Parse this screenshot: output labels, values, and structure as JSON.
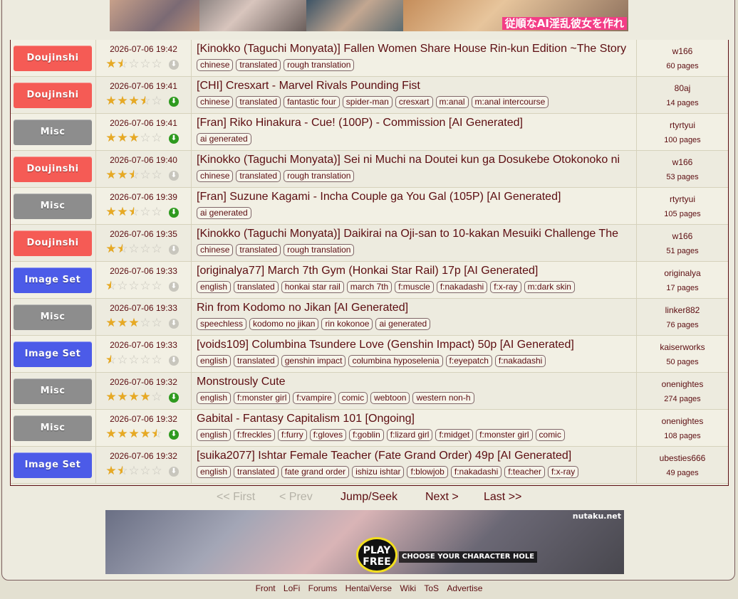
{
  "banner_top": {
    "overlay_text": "従順なAI淫乱彼女を作れ"
  },
  "rows": [
    {
      "category": "Doujinshi",
      "cat_color": "#f55b55",
      "date": "2026-07-06 19:42",
      "rating": 1.5,
      "downloadable": false,
      "title": "[Kinokko (Taguchi Monyata)] Fallen Women Share House Rin-kun Edition ~The Story",
      "tags": [
        "chinese",
        "translated",
        "rough translation"
      ],
      "uploader": "w166",
      "pages": "60 pages"
    },
    {
      "category": "Doujinshi",
      "cat_color": "#f55b55",
      "date": "2026-07-06 19:41",
      "rating": 3.5,
      "downloadable": true,
      "title": "[CHI] Cresxart - Marvel Rivals Pounding Fist",
      "tags": [
        "chinese",
        "translated",
        "fantastic four",
        "spider-man",
        "cresxart",
        "m:anal",
        "m:anal intercourse"
      ],
      "uploader": "80aj",
      "pages": "14 pages"
    },
    {
      "category": "Misc",
      "cat_color": "#8d8d8d",
      "date": "2026-07-06 19:41",
      "rating": 3,
      "downloadable": true,
      "title": "[Fran] Riko Hinakura - Cue! (100P) - Commission [AI Generated]",
      "tags": [
        "ai generated"
      ],
      "uploader": "rtyrtyui",
      "pages": "100 pages"
    },
    {
      "category": "Doujinshi",
      "cat_color": "#f55b55",
      "date": "2026-07-06 19:40",
      "rating": 2.5,
      "downloadable": false,
      "title": "[Kinokko (Taguchi Monyata)] Sei ni Muchi na Doutei kun ga Dosukebe Otokonoko ni",
      "tags": [
        "chinese",
        "translated",
        "rough translation"
      ],
      "uploader": "w166",
      "pages": "53 pages"
    },
    {
      "category": "Misc",
      "cat_color": "#8d8d8d",
      "date": "2026-07-06 19:39",
      "rating": 2.5,
      "downloadable": true,
      "title": "[Fran] Suzune Kagami - Incha Couple ga You Gal (105P) [AI Generated]",
      "tags": [
        "ai generated"
      ],
      "uploader": "rtyrtyui",
      "pages": "105 pages"
    },
    {
      "category": "Doujinshi",
      "cat_color": "#f55b55",
      "date": "2026-07-06 19:35",
      "rating": 1.5,
      "downloadable": false,
      "title": "[Kinokko (Taguchi Monyata)] Daikirai na Oji-san to 10-kakan Mesuiki Challenge The",
      "tags": [
        "chinese",
        "translated",
        "rough translation"
      ],
      "uploader": "w166",
      "pages": "51 pages"
    },
    {
      "category": "Image Set",
      "cat_color": "#4c5be8",
      "date": "2026-07-06 19:33",
      "rating": 0.5,
      "downloadable": false,
      "title": "[originalya77] March 7th Gym (Honkai Star Rail) 17p [AI Generated]",
      "tags": [
        "english",
        "translated",
        "honkai star rail",
        "march 7th",
        "f:muscle",
        "f:nakadashi",
        "f:x-ray",
        "m:dark skin"
      ],
      "uploader": "originalya",
      "pages": "17 pages"
    },
    {
      "category": "Misc",
      "cat_color": "#8d8d8d",
      "date": "2026-07-06 19:33",
      "rating": 3,
      "downloadable": false,
      "title": "Rin from Kodomo no Jikan [AI Generated]",
      "tags": [
        "speechless",
        "kodomo no jikan",
        "rin kokonoe",
        "ai generated"
      ],
      "uploader": "linker882",
      "pages": "76 pages"
    },
    {
      "category": "Image Set",
      "cat_color": "#4c5be8",
      "date": "2026-07-06 19:33",
      "rating": 0.5,
      "downloadable": false,
      "title": "[voids109] Columbina Tsundere Love (Genshin Impact) 50p [AI Generated]",
      "tags": [
        "english",
        "translated",
        "genshin impact",
        "columbina hyposelenia",
        "f:eyepatch",
        "f:nakadashi"
      ],
      "uploader": "kaiserworks",
      "pages": "50 pages"
    },
    {
      "category": "Misc",
      "cat_color": "#8d8d8d",
      "date": "2026-07-06 19:32",
      "rating": 4,
      "downloadable": true,
      "title": "Monstrously Cute",
      "tags": [
        "english",
        "f:monster girl",
        "f:vampire",
        "comic",
        "webtoon",
        "western non-h"
      ],
      "uploader": "onenightes",
      "pages": "274 pages"
    },
    {
      "category": "Misc",
      "cat_color": "#8d8d8d",
      "date": "2026-07-06 19:32",
      "rating": 4.5,
      "downloadable": true,
      "title": "Gabital - Fantasy Capitalism 101 [Ongoing]",
      "tags": [
        "english",
        "f:freckles",
        "f:furry",
        "f:gloves",
        "f:goblin",
        "f:lizard girl",
        "f:midget",
        "f:monster girl",
        "comic"
      ],
      "uploader": "onenightes",
      "pages": "108 pages"
    },
    {
      "category": "Image Set",
      "cat_color": "#4c5be8",
      "date": "2026-07-06 19:32",
      "rating": 1.5,
      "downloadable": false,
      "title": "[suika2077] Ishtar Female Teacher (Fate Grand Order) 49p [AI Generated]",
      "tags": [
        "english",
        "translated",
        "fate grand order",
        "ishizu ishtar",
        "f:blowjob",
        "f:nakadashi",
        "f:teacher",
        "f:x-ray"
      ],
      "uploader": "ubesties666",
      "pages": "49 pages"
    }
  ],
  "pager": {
    "first": "<< First",
    "prev": "< Prev",
    "jump": "Jump/Seek",
    "next": "Next >",
    "last": "Last >>"
  },
  "banner_bottom": {
    "brand": "nutaku.net",
    "play": "PLAY FREE",
    "choose": "CHOOSE YOUR CHARACTER HOLE"
  },
  "footer": {
    "links": [
      "Front",
      "LoFi",
      "Forums",
      "HentaiVerse",
      "Wiki",
      "ToS",
      "Advertise"
    ]
  },
  "colors": {
    "text": "#5c0d11",
    "star": "#e7a923",
    "download": "#2f9a1f"
  }
}
